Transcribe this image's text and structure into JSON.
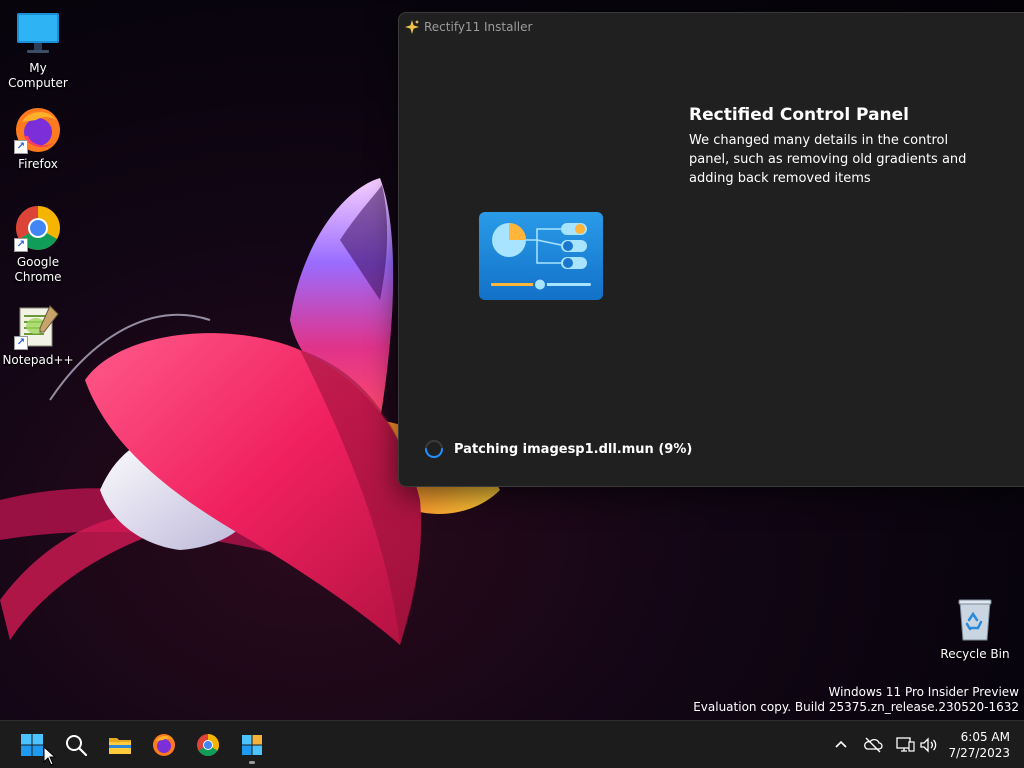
{
  "desktop": {
    "icons": [
      {
        "label": "My Computer",
        "icon": "computer-icon"
      },
      {
        "label": "Firefox",
        "icon": "firefox-icon"
      },
      {
        "label": "Google Chrome",
        "icon": "chrome-icon"
      },
      {
        "label": "Notepad++",
        "icon": "notepadpp-icon"
      }
    ],
    "recycle_bin": {
      "label": "Recycle Bin",
      "icon": "recycle-bin-icon"
    }
  },
  "installer": {
    "title": "Rectify11 Installer",
    "feature_heading": "Rectified Control Panel",
    "feature_description": "We changed many details in the control panel, such as removing old gradients and adding back removed items",
    "status_text": "Patching imagesp1.dll.mun (9%)",
    "progress_percent": 9,
    "accent_color": "#0078d4"
  },
  "watermark": {
    "line1": "Windows 11 Pro Insider Preview",
    "line2": "Evaluation copy. Build 25375.zn_release.230520-1632"
  },
  "taskbar": {
    "items": [
      {
        "name": "start",
        "icon": "windows-logo-icon"
      },
      {
        "name": "search",
        "icon": "search-icon"
      },
      {
        "name": "file-explorer",
        "icon": "folder-icon"
      },
      {
        "name": "firefox",
        "icon": "firefox-icon"
      },
      {
        "name": "chrome",
        "icon": "chrome-icon"
      },
      {
        "name": "rectify11-installer",
        "icon": "installer-icon",
        "running": true
      }
    ],
    "tray": [
      "chevron-up-icon",
      "onedrive-offline-icon",
      "network-icon",
      "volume-icon"
    ],
    "clock": {
      "time": "6:05 AM",
      "date": "7/27/2023"
    }
  }
}
